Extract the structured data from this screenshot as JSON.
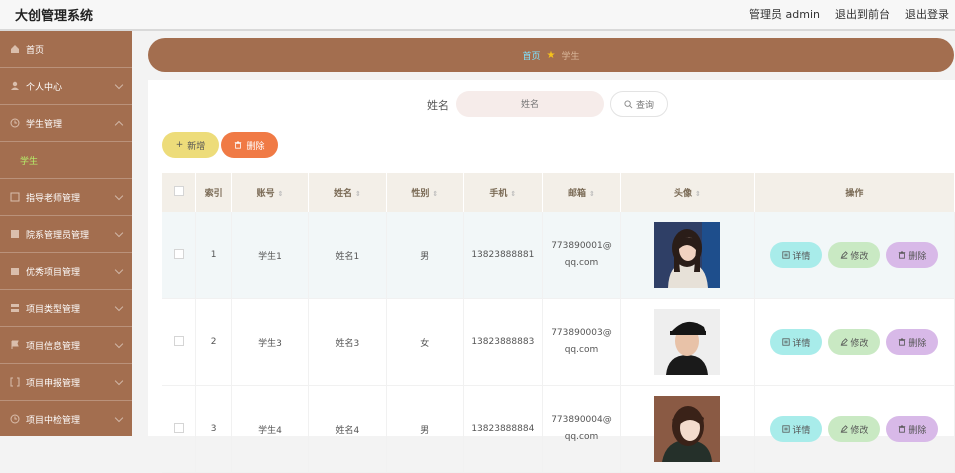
{
  "header": {
    "title": "大创管理系统",
    "nav": [
      "管理员 admin",
      "退出到前台",
      "退出登录"
    ]
  },
  "sidebar": {
    "items": [
      {
        "label": "首页",
        "icon": "home-icon"
      },
      {
        "label": "个人中心",
        "icon": "user-icon"
      },
      {
        "label": "学生管理",
        "icon": "clock-icon",
        "sub": "学生"
      },
      {
        "label": "指导老师管理",
        "icon": "book-icon"
      },
      {
        "label": "院系管理员管理",
        "icon": "grid-icon"
      },
      {
        "label": "优秀项目管理",
        "icon": "box-icon"
      },
      {
        "label": "项目类型管理",
        "icon": "stack-icon"
      },
      {
        "label": "项目信息管理",
        "icon": "flag-icon"
      },
      {
        "label": "项目申报管理",
        "icon": "bracket-icon"
      },
      {
        "label": "项目中检管理",
        "icon": "clock-icon"
      }
    ]
  },
  "breadcrumb": {
    "home": "首页",
    "current": "学生"
  },
  "search": {
    "label": "姓名",
    "placeholder": "姓名",
    "button": "查询"
  },
  "toolbar": {
    "add": "新增",
    "delete": "删除"
  },
  "table": {
    "columns": [
      "索引",
      "账号",
      "姓名",
      "性别",
      "手机",
      "邮箱",
      "头像",
      "操作"
    ],
    "rows": [
      {
        "index": "1",
        "account": "学生1",
        "name": "姓名1",
        "gender": "男",
        "phone": "13823888881",
        "email1": "773890001@",
        "email2": "qq.com"
      },
      {
        "index": "2",
        "account": "学生3",
        "name": "姓名3",
        "gender": "女",
        "phone": "13823888883",
        "email1": "773890003@",
        "email2": "qq.com"
      },
      {
        "index": "3",
        "account": "学生4",
        "name": "姓名4",
        "gender": "男",
        "phone": "13823888884",
        "email1": "773890004@",
        "email2": "qq.com"
      }
    ],
    "actions": {
      "detail": "详情",
      "edit": "修改",
      "delete": "删除"
    }
  }
}
